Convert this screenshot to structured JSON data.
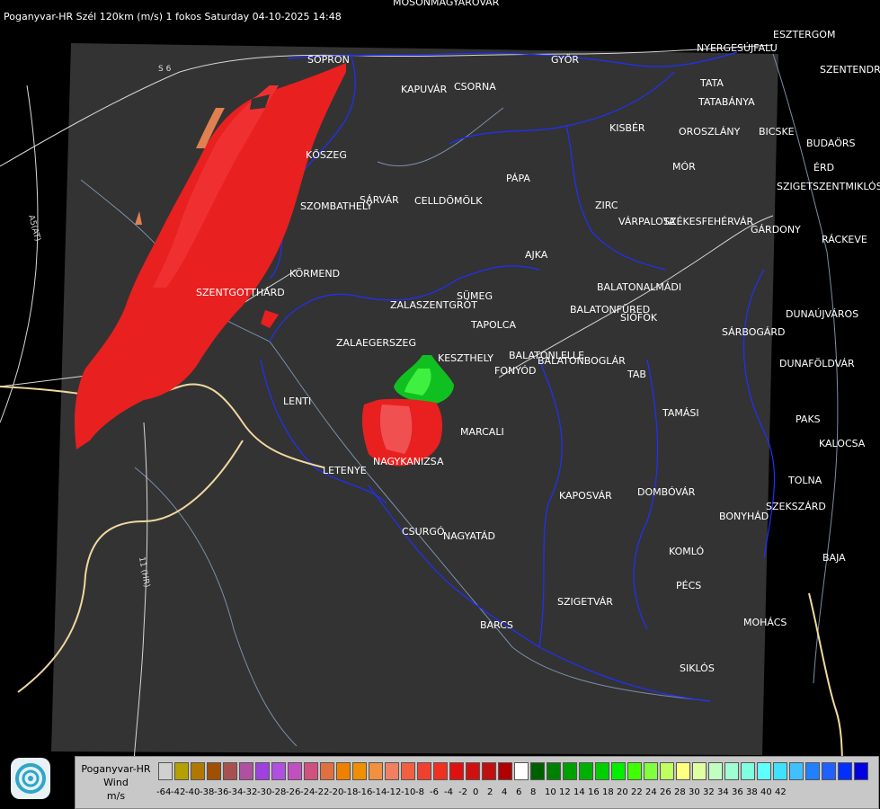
{
  "title": "Poganyvar-HR Szél 120km (m/s) 1 fokos Saturday 04-10-2025 14:48",
  "road_labels": [
    "S 6",
    "A5(AT)",
    "11 (HR)"
  ],
  "cities": [
    "MOSONMAGYARÓVÁR",
    "SOPRON",
    "KAPUVÁR",
    "CSORNA",
    "GYŐR",
    "KISBÉR",
    "TATA",
    "TATABÁNYA",
    "ESZTERGOM",
    "NYERGESÚJFALU",
    "SZENTENDRE",
    "OROSZLÁNY",
    "BICSKE",
    "BUDAÖRS",
    "ÉRD",
    "SZIGETSZENTMIKLÓS",
    "MÓR",
    "KŐSZEG",
    "SZOMBATHELY",
    "SÁRVÁR",
    "CELLDÖMÖLK",
    "PÁPA",
    "ZIRC",
    "VÁRPALOTA",
    "SZÉKESFEHÉRVÁR",
    "GÁRDONY",
    "RÁCKEVE",
    "AJKA",
    "KÖRMEND",
    "SZENTGOTTHÁRD",
    "SÜMEG",
    "ZALASZENTGRÓT",
    "BALATONALMÁDI",
    "BALATONFÜRED",
    "SIÓFOK",
    "TAPOLCA",
    "ZALAEGERSZEG",
    "KESZTHELY",
    "BALATONLELLE",
    "FONYÓD",
    "BALATONBOGLÁR",
    "DUNAÚJVÁROS",
    "SÁRBOGÁRD",
    "DUNAFÖLDVÁR",
    "LENTI",
    "TAB",
    "TAMÁSI",
    "PAKS",
    "MARCALI",
    "KALOCSA",
    "NAGYKANIZSA",
    "LETENYE",
    "KAPOSVÁR",
    "DOMBÓVÁR",
    "TOLNA",
    "SZEKSZÁRD",
    "BONYHÁD",
    "CSURGÓ",
    "NAGYATÁD",
    "KOMLÓ",
    "BAJA",
    "PÉCS",
    "SZIGETVÁR",
    "MOHÁCS",
    "BARCS",
    "SIKLÓS"
  ],
  "legend": {
    "name_line1": "Poganyvar-HR",
    "name_line2": "Wind",
    "unit": "m/s",
    "ticks": [
      "-64",
      "-42",
      "-40",
      "-38",
      "-36",
      "-34",
      "-32",
      "-30",
      "-28",
      "-26",
      "-24",
      "-22",
      "-20",
      "-18",
      "-16",
      "-14",
      "-12",
      "-10",
      "-8",
      "-6",
      "-4",
      "-2",
      "0",
      "2",
      "4",
      "6",
      "8",
      "10",
      "12",
      "14",
      "16",
      "18",
      "20",
      "22",
      "24",
      "26",
      "28",
      "30",
      "32",
      "34",
      "36",
      "38",
      "40",
      "42"
    ],
    "colors": [
      "#d0d0d0",
      "#b5a000",
      "#b07800",
      "#a05000",
      "#a85050",
      "#b050a0",
      "#a040e0",
      "#b050e0",
      "#c050c0",
      "#d05080",
      "#e07040",
      "#f08000",
      "#f09000",
      "#f09040",
      "#f08060",
      "#f06040",
      "#f04030",
      "#f03020",
      "#e01010",
      "#d01010",
      "#c01010",
      "#b00000",
      "#ffffff",
      "#006000",
      "#008000",
      "#00a000",
      "#00b000",
      "#00d000",
      "#00f000",
      "#40ff00",
      "#80ff40",
      "#c0ff60",
      "#ffff80",
      "#e0ffa0",
      "#c0ffc0",
      "#a0ffd0",
      "#80ffe0",
      "#60ffff",
      "#40e0ff",
      "#40c0ff",
      "#2080ff",
      "#2060ff",
      "#0030ff",
      "#0000e0"
    ]
  }
}
